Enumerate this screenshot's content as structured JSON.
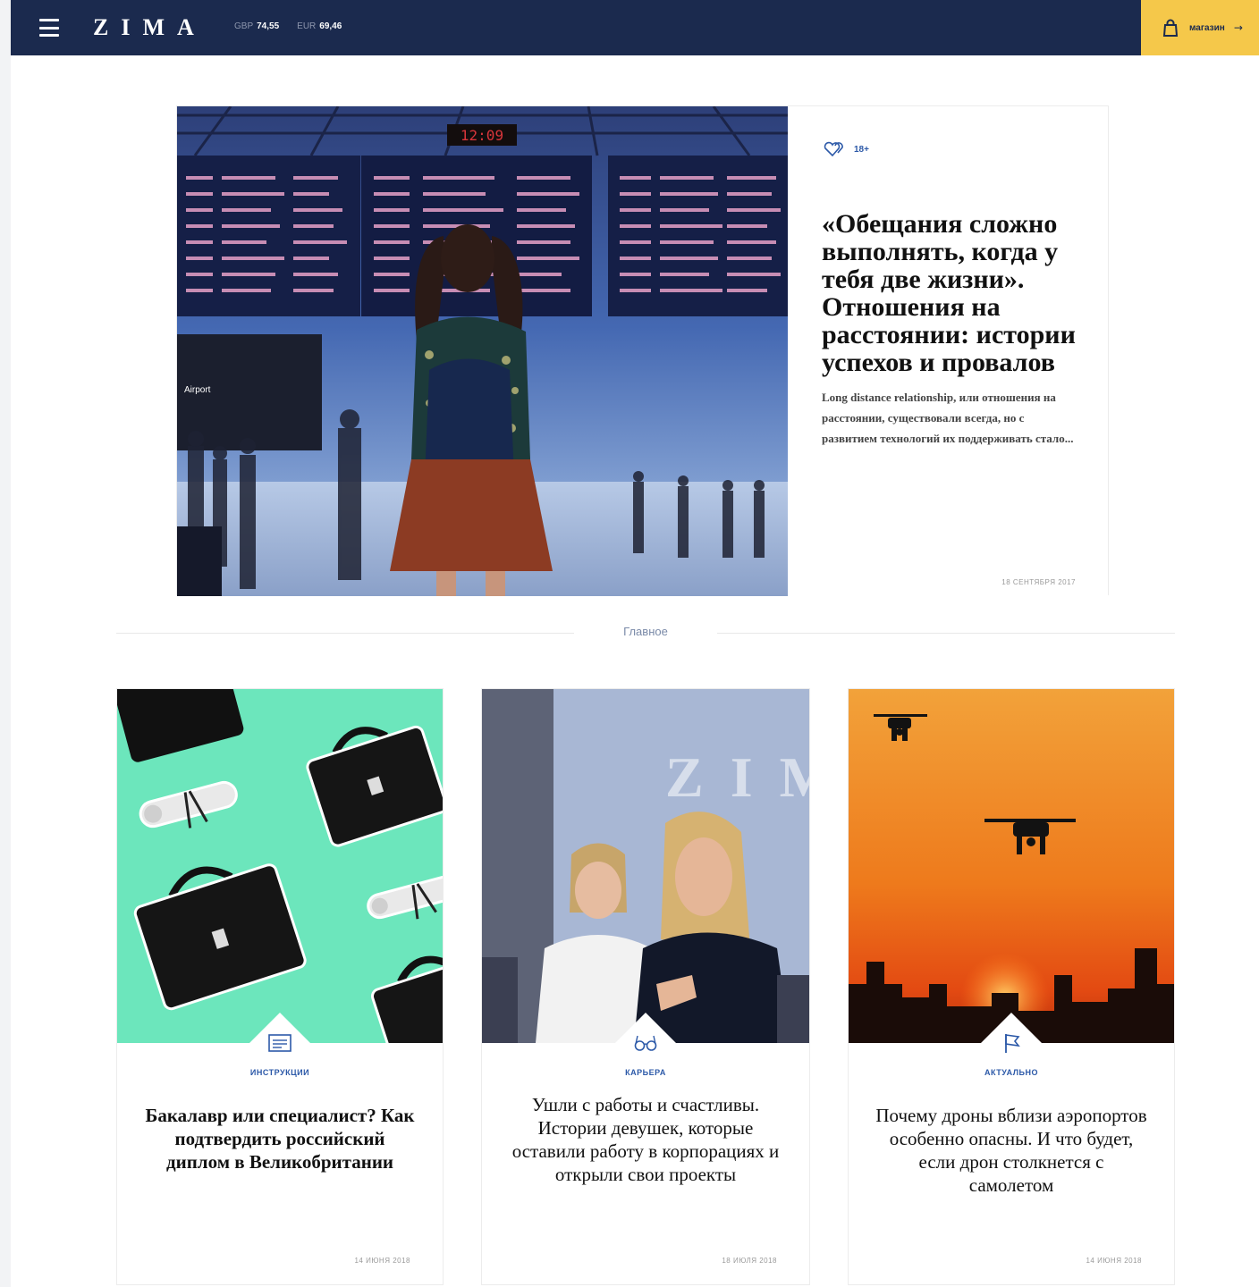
{
  "header": {
    "logo": "ZIMA",
    "rates": [
      {
        "currency": "GBP",
        "value": "74,55"
      },
      {
        "currency": "EUR",
        "value": "69,46"
      }
    ],
    "shop_label": "магазин",
    "shop_arrow": "→",
    "bg_color": "#1b2a4e",
    "accent_color": "#f5c84a"
  },
  "hero": {
    "tag": "18+",
    "title": "«Обещания сложно выполнять, когда у тебя две жизни». Отношения на расстоянии: истории успехов и провалов",
    "excerpt": "Long distance relationship, или отношения на расстоянии, существовали всегда, но с развитием технологий их поддерживать стало...",
    "date": "18 СЕНТЯБРЯ 2017",
    "image_caption": "Airport",
    "board_clock": "12:09"
  },
  "section": {
    "title": "Главное"
  },
  "cards": [
    {
      "icon": "list-icon",
      "tag": "ИНСТРУКЦИИ",
      "title": "Бакалавр или специалист? Как подтвердить российский диплом в Великобритании",
      "date": "14 ИЮНЯ 2018"
    },
    {
      "icon": "glasses-icon",
      "tag": "КАРЬЕРА",
      "title": "Ушли с работы и счастливы. Истории девушек, которые оставили работу в корпорациях и открыли свои проекты",
      "date": "18 ИЮЛЯ 2018"
    },
    {
      "icon": "flag-icon",
      "tag": "АКТУАЛЬНО",
      "title": "Почему дроны вблизи аэропортов особенно опасны. И что будет, если дрон столкнется с самолетом",
      "date": "14 ИЮНЯ 2018"
    }
  ]
}
